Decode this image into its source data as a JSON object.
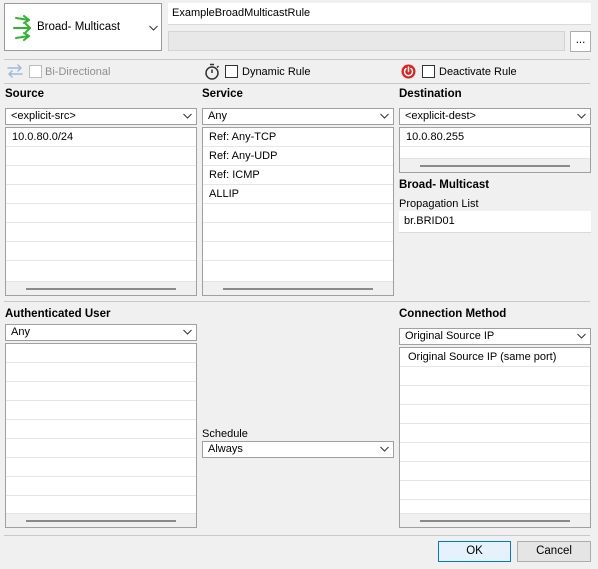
{
  "header": {
    "rule_type_label": "Broad- Multicast",
    "rule_name_value": "ExampleBroadMulticastRule",
    "comment_value": "",
    "more_button_label": "...",
    "icon": "multicast-arrows-icon"
  },
  "options": {
    "bidirectional_label": "Bi-Directional",
    "bidirectional_checked": false,
    "dynamic_rule_label": "Dynamic Rule",
    "dynamic_rule_checked": false,
    "deactivate_rule_label": "Deactivate Rule",
    "deactivate_rule_checked": false
  },
  "source": {
    "header": "Source",
    "selected": "<explicit-src>",
    "items": [
      "10.0.80.0/24"
    ]
  },
  "service": {
    "header": "Service",
    "selected": "Any",
    "items": [
      "Ref: Any-TCP",
      "Ref: Any-UDP",
      "Ref: ICMP",
      "ALLIP"
    ]
  },
  "destination": {
    "header": "Destination",
    "selected": "<explicit-dest>",
    "items": [
      "10.0.80.255"
    ]
  },
  "multicast": {
    "header": "Broad- Multicast",
    "propagation_label": "Propagation List",
    "propagation_value": "br.BRID01"
  },
  "auth_user": {
    "header": "Authenticated User",
    "selected": "Any",
    "items": []
  },
  "schedule": {
    "label": "Schedule",
    "selected": "Always"
  },
  "connection": {
    "header": "Connection Method",
    "selected": "Original Source IP",
    "items": [
      "Original Source IP (same port)"
    ]
  },
  "footer": {
    "ok_label": "OK",
    "cancel_label": "Cancel"
  },
  "colors": {
    "accent": "#0078d7",
    "multicast_icon": "#2db52d",
    "deactivate_icon": "#e02020",
    "bidirectional_disabled": "#9dbbd8"
  }
}
